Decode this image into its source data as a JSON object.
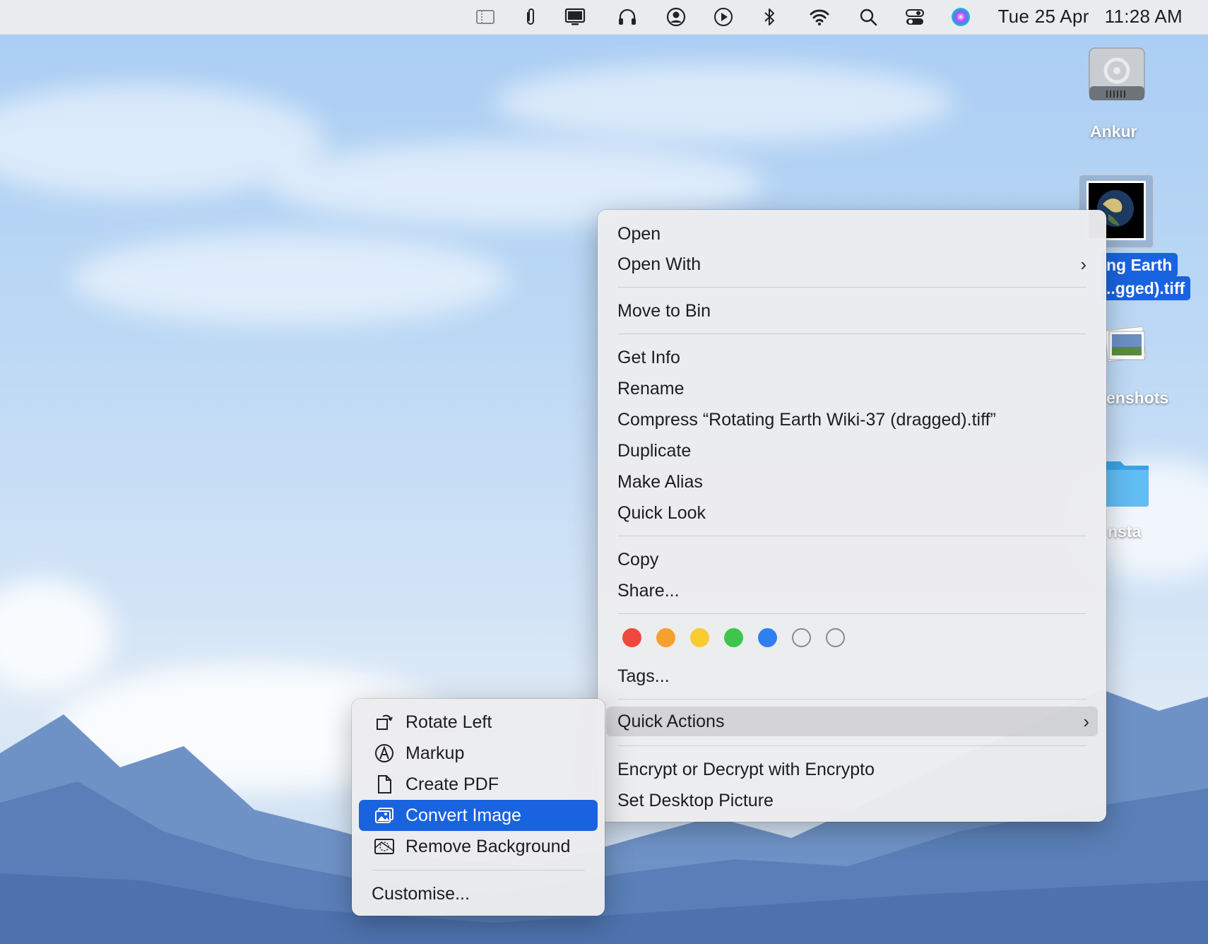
{
  "menubar": {
    "icons": [
      "sidebar-icon",
      "paperclip-icon",
      "display-icon",
      "headphones-icon",
      "user-circle-icon",
      "play-circle-icon",
      "bluetooth-icon",
      "wifi-icon",
      "search-icon",
      "control-center-icon",
      "siri-icon"
    ],
    "date": "Tue 25 Apr",
    "time": "11:28 AM"
  },
  "desktop": {
    "drive_label": "Ankur",
    "selected_file_line1": "ng Earth",
    "selected_file_line2": "..gged).tiff",
    "screenshots_label": "enshots",
    "folder_label": "nsta"
  },
  "context_menu": {
    "open": "Open",
    "open_with": "Open With",
    "move_to_bin": "Move to Bin",
    "get_info": "Get Info",
    "rename": "Rename",
    "compress": "Compress “Rotating Earth Wiki-37 (dragged).tiff”",
    "duplicate": "Duplicate",
    "make_alias": "Make Alias",
    "quick_look": "Quick Look",
    "copy": "Copy",
    "share": "Share...",
    "tags": "Tags...",
    "quick_actions": "Quick Actions",
    "encrypt": "Encrypt or Decrypt with Encrypto",
    "set_desktop": "Set Desktop Picture",
    "tag_colors": [
      "#f0483e",
      "#f7a02d",
      "#f8cb30",
      "#3ec54a",
      "#2f7ff0",
      "empty",
      "empty"
    ]
  },
  "quick_actions_menu": {
    "rotate_left": "Rotate Left",
    "markup": "Markup",
    "create_pdf": "Create PDF",
    "convert_image": "Convert Image",
    "remove_background": "Remove Background",
    "customise": "Customise..."
  }
}
